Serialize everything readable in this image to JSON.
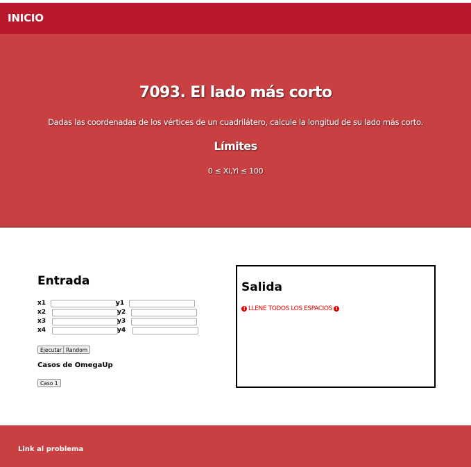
{
  "nav": {
    "home_label": "INICIO"
  },
  "hero": {
    "title": "7093. El lado más corto",
    "description": "Dadas las coordenadas de los vértices de un cuadrilátero, calcule la longitud de su lado más corto.",
    "limits_heading": "Límites",
    "limits_text": "0 ≤ Xi,Yi ≤ 100"
  },
  "entrada": {
    "heading": "Entrada",
    "fields": [
      {
        "label": "x1",
        "value": ""
      },
      {
        "label": "y1",
        "value": ""
      },
      {
        "label": "x2",
        "value": ""
      },
      {
        "label": "y2",
        "value": ""
      },
      {
        "label": "x3",
        "value": ""
      },
      {
        "label": "y3",
        "value": ""
      },
      {
        "label": "x4",
        "value": ""
      },
      {
        "label": "y4",
        "value": ""
      }
    ],
    "run_label": "Ejecutar",
    "random_label": "Random",
    "cases_heading": "Casos de OmegaUp",
    "case1_label": "Caso 1"
  },
  "salida": {
    "heading": "Salida",
    "error_text": "LLENE TODOS LOS ESPACIOS",
    "error_icon": "exclamation-circle-icon",
    "error_color": "#e00000"
  },
  "footer": {
    "link_label": "Link al problema"
  },
  "colors": {
    "navbar": "#b9192d",
    "hero": "#c84042"
  }
}
